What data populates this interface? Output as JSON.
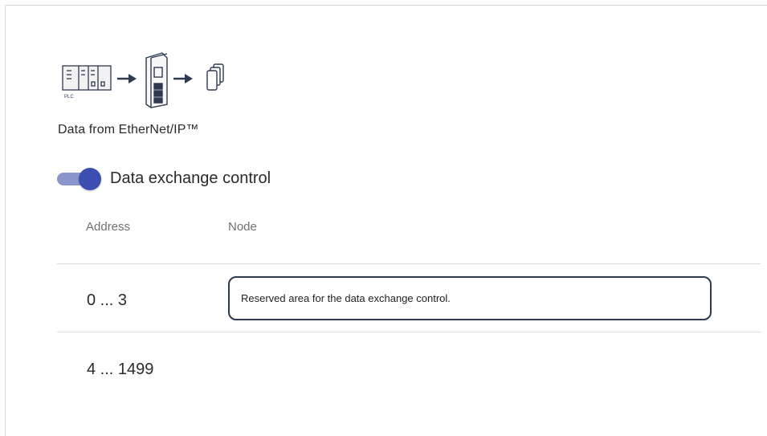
{
  "section": {
    "title": "Data from EtherNet/IP™",
    "flow_icons": [
      "plc-icon",
      "arrow-right-icon",
      "gateway-device-icon",
      "arrow-right-icon",
      "data-pages-icon"
    ],
    "plc_label": "PLC"
  },
  "toggle": {
    "label": "Data exchange control",
    "state": "on"
  },
  "table": {
    "headers": {
      "address": "Address",
      "node": "Node"
    },
    "rows": [
      {
        "address": "0 ... 3",
        "node": "Reserved area for the data exchange control."
      },
      {
        "address": "4 ... 1499",
        "node": ""
      }
    ]
  },
  "colors": {
    "toggle_track": "#8b96cc",
    "toggle_knob": "#3b4fb0",
    "node_border": "#2d3a4f"
  }
}
